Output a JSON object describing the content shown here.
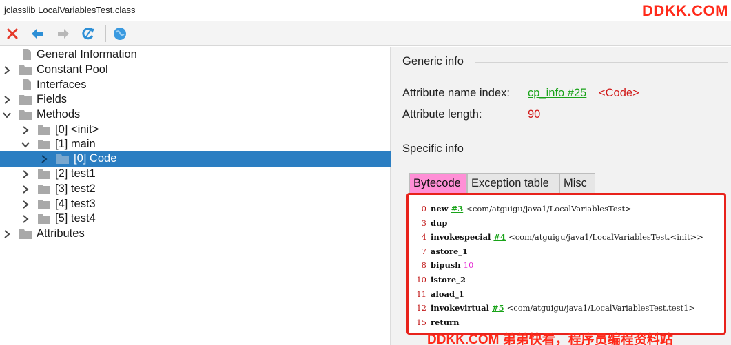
{
  "window": {
    "title": "jclasslib LocalVariablesTest.class"
  },
  "watermark": {
    "top": "DDKK.COM",
    "bottom": "DDKK.COM 弟弟快看，程序员编程资料站"
  },
  "toolbar": {
    "buttons": [
      {
        "name": "close-icon",
        "color": "#e53a2b"
      },
      {
        "name": "back-arrow-icon",
        "color": "#2d8fd6"
      },
      {
        "name": "forward-arrow-icon",
        "color": "#b8b8b8"
      },
      {
        "name": "refresh-icon",
        "color": "#2d8fd6"
      },
      {
        "name": "web-globe-icon",
        "color": "#2d8fd6"
      }
    ]
  },
  "tree": {
    "general_information": "General Information",
    "constant_pool": "Constant Pool",
    "interfaces": "Interfaces",
    "fields": "Fields",
    "methods": "Methods",
    "m0_init": "[0] <init>",
    "m1_main": "[1] main",
    "m1_code": "[0] Code",
    "m2_test1": "[2] test1",
    "m3_test2": "[3] test2",
    "m4_test3": "[4] test3",
    "m5_test4": "[5] test4",
    "attributes": "Attributes"
  },
  "detail": {
    "generic_info": "Generic info",
    "attr_name_index_label": "Attribute name index:",
    "attr_name_index_link": "cp_info #25",
    "attr_name_index_value": "<Code>",
    "attr_length_label": "Attribute length:",
    "attr_length_value": "90",
    "specific_info": "Specific info",
    "tabs": [
      "Bytecode",
      "Exception table",
      "Misc"
    ]
  },
  "bytecode": [
    {
      "idx": "0",
      "op": "new",
      "ref": "#3",
      "comment": "<com/atguigu/java1/LocalVariablesTest>"
    },
    {
      "idx": "3",
      "op": "dup"
    },
    {
      "idx": "4",
      "op": "invokespecial",
      "ref": "#4",
      "comment": "<com/atguigu/java1/LocalVariablesTest.<init>>"
    },
    {
      "idx": "7",
      "op": "astore_1"
    },
    {
      "idx": "8",
      "op": "bipush",
      "num": "10"
    },
    {
      "idx": "10",
      "op": "istore_2"
    },
    {
      "idx": "11",
      "op": "aload_1"
    },
    {
      "idx": "12",
      "op": "invokevirtual",
      "ref": "#5",
      "comment": "<com/atguigu/java1/LocalVariablesTest.test1>"
    },
    {
      "idx": "15",
      "op": "return"
    }
  ],
  "colors": {
    "selection": "#2b7ec2",
    "link": "#19a319",
    "accent_red": "#d11a1a",
    "active_tab": "#ff8fd6",
    "highlight_box": "#e8221b"
  }
}
